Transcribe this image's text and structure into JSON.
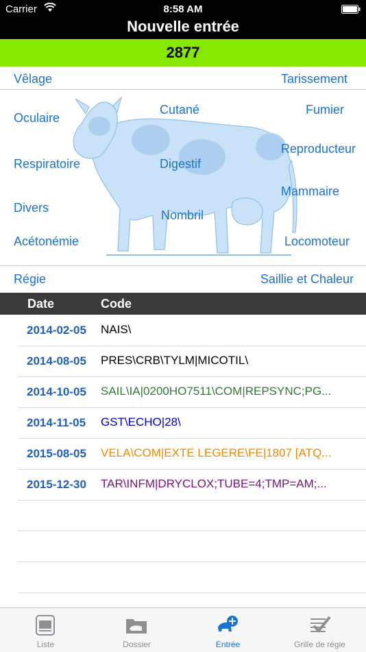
{
  "status": {
    "carrier": "Carrier",
    "time": "8:58 AM"
  },
  "nav": {
    "title": "Nouvelle entrée"
  },
  "animal": {
    "id": "2877"
  },
  "top_links": {
    "left": "Vêlage",
    "right": "Tarissement"
  },
  "categories": {
    "oculaire": "Oculaire",
    "cutane": "Cutané",
    "fumier": "Fumier",
    "respiratoire": "Respiratoire",
    "digestif": "Digestif",
    "reproducteur": "Reproducteur",
    "mammaire": "Mammaire",
    "divers": "Divers",
    "nombril": "Nombril",
    "acetonemie": "Acétonémie",
    "locomoteur": "Locomoteur"
  },
  "bottom_links": {
    "left": "Régie",
    "right": "Saillie et Chaleur"
  },
  "list": {
    "headers": {
      "date": "Date",
      "code": "Code"
    },
    "rows": [
      {
        "date": "2014-02-05",
        "code": "NAIS\\",
        "color": "#000000"
      },
      {
        "date": "2014-08-05",
        "code": "PRES\\CRB\\TYLM|MICOTIL\\",
        "color": "#000000"
      },
      {
        "date": "2014-10-05",
        "code": "SAIL\\IA|0200HO7511\\COM|REPSYNC;PG...",
        "color": "#2e7d32"
      },
      {
        "date": "2014-11-05",
        "code": "GST\\ECHO|28\\",
        "color": "#0000cc"
      },
      {
        "date": "2015-08-05",
        "code": "VELA\\COM|EXTE LEGERE\\FE|1807 [ATQ...",
        "color": "#f08a00"
      },
      {
        "date": "2015-12-30",
        "code": "TAR\\INFM|DRYCLOX;TUBE=4;TMP=AM;...",
        "color": "#7b1380"
      }
    ]
  },
  "tabs": [
    {
      "label": "Liste",
      "icon": "list-icon"
    },
    {
      "label": "Dossier",
      "icon": "folder-icon"
    },
    {
      "label": "Entrée",
      "icon": "cow-add-icon",
      "active": true
    },
    {
      "label": "Grille de régie",
      "icon": "grid-check-icon"
    }
  ],
  "colors": {
    "id_bar": "#86e800",
    "link": "#1a73d1",
    "date": "#1f5fc2"
  }
}
